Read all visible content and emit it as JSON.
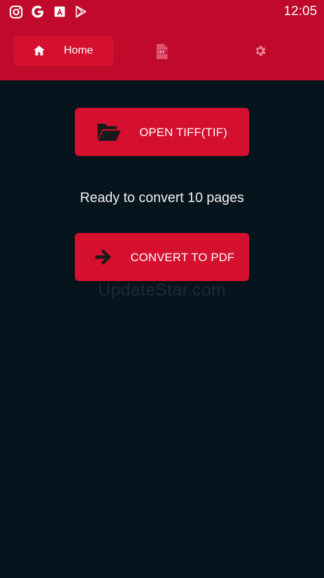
{
  "status_bar": {
    "time": "12:05",
    "notification_icons": [
      "instagram-icon",
      "google-icon",
      "adobe-acrobat-icon",
      "play-store-icon"
    ]
  },
  "tabs": [
    {
      "id": "home",
      "label": "Home",
      "icon": "home-icon",
      "selected": true
    },
    {
      "id": "pdf",
      "label": "",
      "icon": "pdf-file-icon",
      "selected": false
    },
    {
      "id": "settings",
      "label": "",
      "icon": "gear-icon",
      "selected": false
    }
  ],
  "main": {
    "open_button_label": "OPEN TIFF(TIF)",
    "open_button_icon": "folder-open-icon",
    "status_message": "Ready to convert 10 pages",
    "convert_button_label": "CONVERT TO PDF",
    "convert_button_icon": "arrow-right-icon",
    "watermark": "UpdateStar.com"
  },
  "colors": {
    "header": "#bf0a2c",
    "accent": "#d5102f",
    "background": "#06141d",
    "text": "#ffffff"
  }
}
